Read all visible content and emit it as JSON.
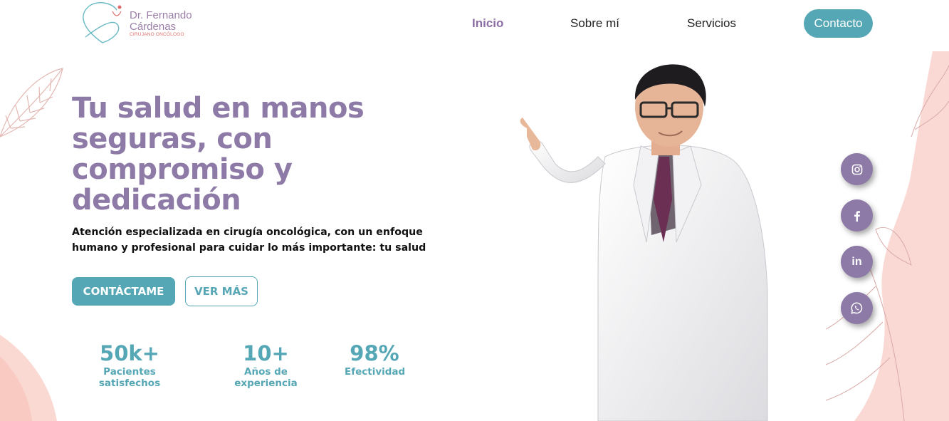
{
  "header": {
    "logo": {
      "name_line1": "Dr. Fernando",
      "name_line2": "Cárdenas",
      "subtitle": "CIRUJANO ONCÓLOGO"
    },
    "nav": [
      {
        "label": "Inicio",
        "active": true
      },
      {
        "label": "Sobre mí",
        "active": false
      },
      {
        "label": "Servicios",
        "active": false
      }
    ],
    "cta_label": "Contacto"
  },
  "hero": {
    "title": "Tu salud en manos seguras, con compromiso y dedicación",
    "subtitle": "Atención especializada en cirugía oncológica, con un enfoque humano y profesional para cuidar lo más importante: tu salud",
    "primary_button": "CONTÁCTAME",
    "secondary_button": "VER MÁS",
    "stats": [
      {
        "value": "50k+",
        "label": "Pacientes satisfechos"
      },
      {
        "value": "10+",
        "label": "Años de experiencia"
      },
      {
        "value": "98%",
        "label": "Efectividad"
      }
    ]
  },
  "social": [
    {
      "icon": "instagram-icon",
      "glyph": "◎"
    },
    {
      "icon": "facebook-icon",
      "glyph": "f"
    },
    {
      "icon": "linkedin-icon",
      "glyph": "in"
    },
    {
      "icon": "whatsapp-icon",
      "glyph": "✆"
    }
  ],
  "colors": {
    "brand_purple": "#8d7aa6",
    "brand_teal": "#55a7b5",
    "accent_pink": "#f8d3cf"
  }
}
